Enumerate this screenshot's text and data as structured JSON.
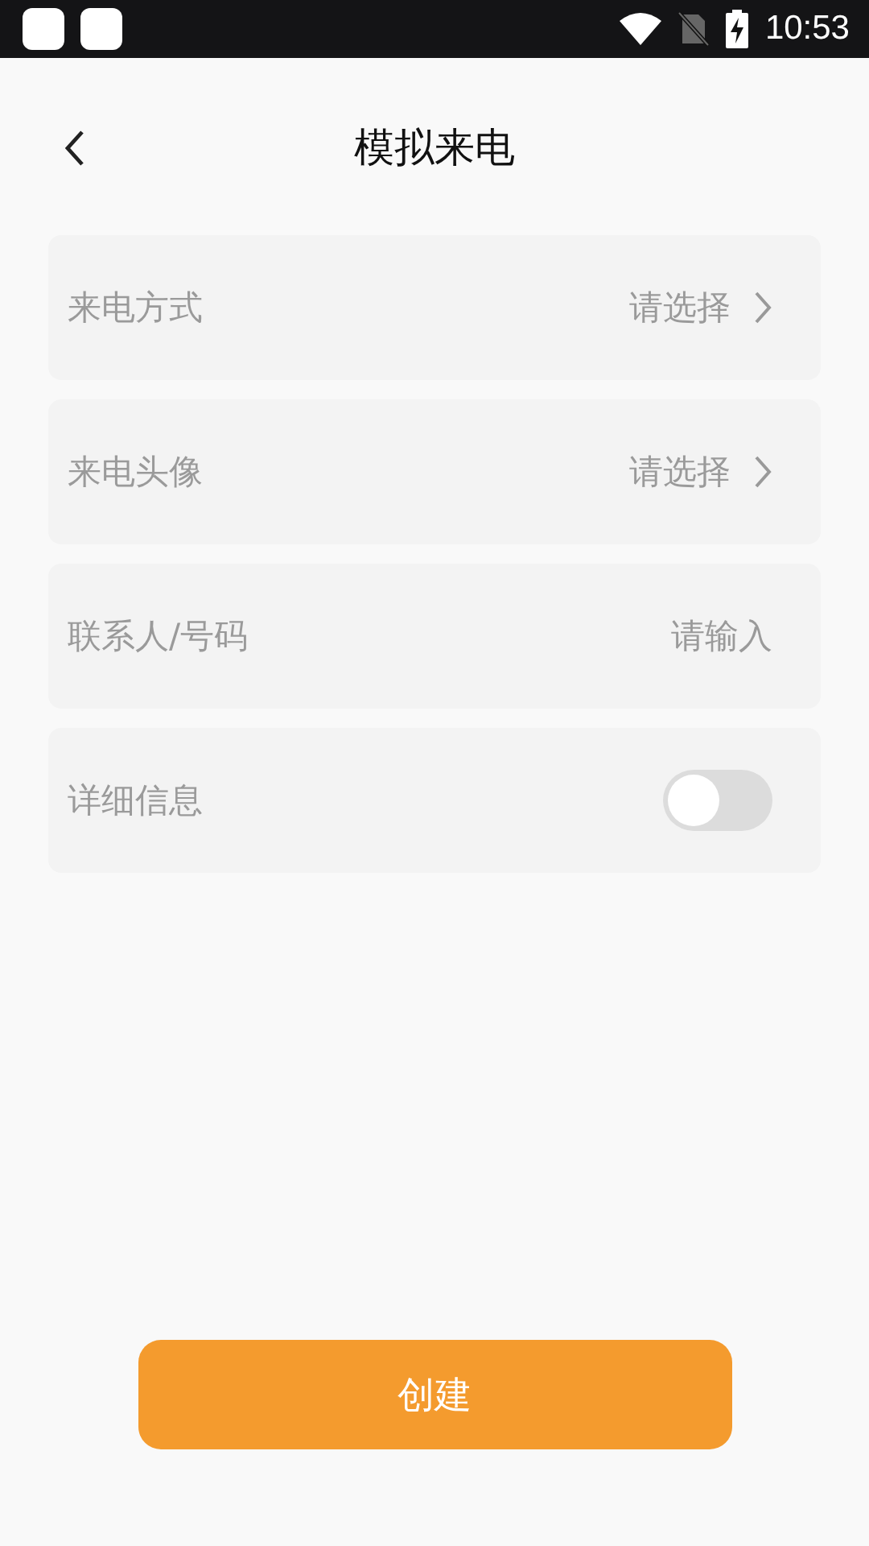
{
  "status_bar": {
    "time": "10:53"
  },
  "header": {
    "title": "模拟来电"
  },
  "form_rows": [
    {
      "kind": "select",
      "label": "来电方式",
      "value": "请选择"
    },
    {
      "kind": "select",
      "label": "来电头像",
      "value": "请选择"
    },
    {
      "kind": "input",
      "label": "联系人/号码",
      "placeholder": "请输入"
    },
    {
      "kind": "toggle",
      "label": "详细信息",
      "on": false
    }
  ],
  "create_button": {
    "label": "创建"
  }
}
